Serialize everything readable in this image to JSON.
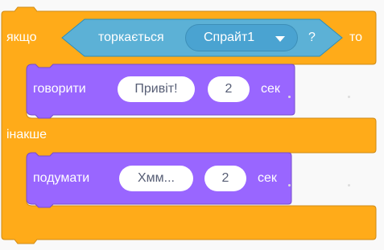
{
  "colors": {
    "control": "#ffab19",
    "control_dark": "#cf8b17",
    "sensing": "#5cb1d6",
    "sensing_dark": "#2e8eb8",
    "looks": "#9966ff",
    "looks_dark": "#774dcb",
    "workspace": "#f9f9f9"
  },
  "if_block": {
    "if_label": "якщо",
    "then_label": "то",
    "else_label": "інакше",
    "condition": {
      "label": "торкається",
      "dropdown_value": "Спрайт1",
      "dropdown_icon": "caret-down-icon",
      "question": "?"
    }
  },
  "say_block": {
    "label": "говорити",
    "message": "Привіт!",
    "seconds": "2",
    "unit": "сек"
  },
  "think_block": {
    "label": "подумати",
    "message": "Хмм...",
    "seconds": "2",
    "unit": "сек"
  }
}
